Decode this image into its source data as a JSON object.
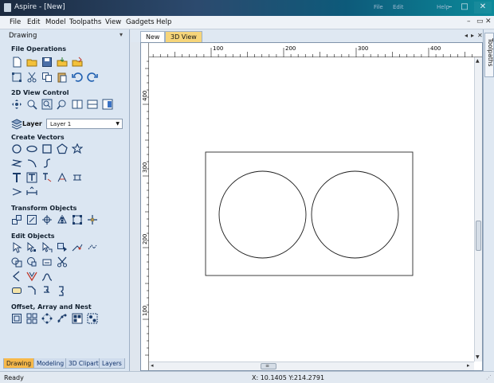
{
  "window": {
    "title": "Aspire - [New]",
    "ghost_menu": [
      "File",
      "Edit",
      "Help"
    ],
    "buttons": {
      "minimize": "–",
      "maximize": "□",
      "close": "✕"
    }
  },
  "menubar": {
    "items": [
      "File",
      "Edit",
      "Model",
      "Toolpaths",
      "View",
      "Gadgets",
      "Help"
    ],
    "mdi_buttons": [
      "–",
      "▭",
      "✕"
    ]
  },
  "left_panel": {
    "title": "Drawing",
    "pin": "▾",
    "sections": {
      "file_operations": "File Operations",
      "view_control": "2D View Control",
      "create_vectors": "Create Vectors",
      "transform_objects": "Transform Objects",
      "edit_objects": "Edit Objects",
      "offset_array_nest": "Offset, Array and Nest"
    },
    "layer": {
      "label": "Layer",
      "value": "Layer 1",
      "arrow": "▼"
    },
    "bottom_tabs": [
      "Drawing",
      "Modeling",
      "3D Clipart",
      "Layers"
    ]
  },
  "doc_tabs": {
    "new": "New",
    "view3d": "3D View",
    "nav_left": "◂",
    "nav_right": "▸",
    "close": "✕"
  },
  "ruler": {
    "top_labels": [
      "100",
      "200",
      "300",
      "400"
    ],
    "left_labels": [
      "400",
      "300",
      "200",
      "100"
    ]
  },
  "right_strip": {
    "tab": "Toolpaths"
  },
  "scroll_arrows": {
    "up": "▲",
    "down": "▼",
    "left": "◂",
    "right": "▸",
    "grip": "≡"
  },
  "statusbar": {
    "ready": "Ready",
    "coords": "X: 10.1405 Y:214.2791",
    "grip": "⋰"
  },
  "colors": {
    "accent_tab": "#f7b94a",
    "panel_bg": "#dbe6f2",
    "titlebar": "#1b2a3f"
  }
}
